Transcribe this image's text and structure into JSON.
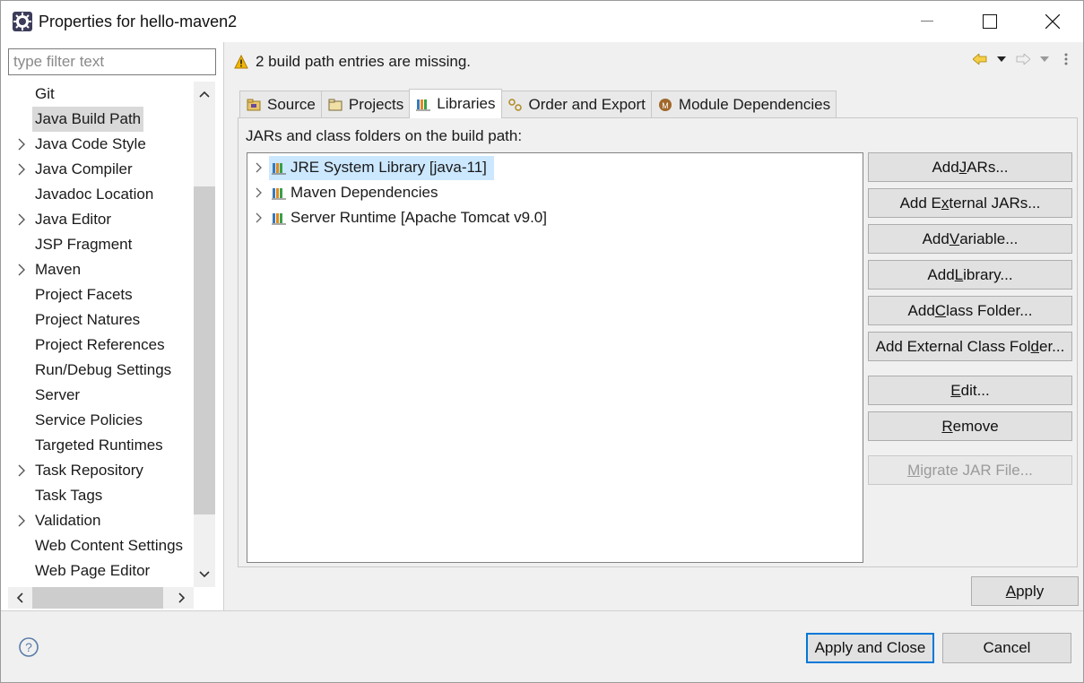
{
  "window": {
    "title": "Properties for hello-maven2"
  },
  "sidebar": {
    "filter_placeholder": "type filter text",
    "items": [
      {
        "label": "Git",
        "expandable": false
      },
      {
        "label": "Java Build Path",
        "expandable": false,
        "selected": true
      },
      {
        "label": "Java Code Style",
        "expandable": true
      },
      {
        "label": "Java Compiler",
        "expandable": true
      },
      {
        "label": "Javadoc Location",
        "expandable": false
      },
      {
        "label": "Java Editor",
        "expandable": true
      },
      {
        "label": "JSP Fragment",
        "expandable": false
      },
      {
        "label": "Maven",
        "expandable": true
      },
      {
        "label": "Project Facets",
        "expandable": false
      },
      {
        "label": "Project Natures",
        "expandable": false
      },
      {
        "label": "Project References",
        "expandable": false
      },
      {
        "label": "Run/Debug Settings",
        "expandable": false
      },
      {
        "label": "Server",
        "expandable": false
      },
      {
        "label": "Service Policies",
        "expandable": false
      },
      {
        "label": "Targeted Runtimes",
        "expandable": false
      },
      {
        "label": "Task Repository",
        "expandable": true
      },
      {
        "label": "Task Tags",
        "expandable": false
      },
      {
        "label": "Validation",
        "expandable": true
      },
      {
        "label": "Web Content Settings",
        "expandable": false
      },
      {
        "label": "Web Page Editor",
        "expandable": false
      }
    ]
  },
  "header": {
    "message": "2 build path entries are missing."
  },
  "tabs": [
    {
      "label": "Source",
      "icon": "source-folder-icon"
    },
    {
      "label": "Projects",
      "icon": "projects-folder-icon"
    },
    {
      "label": "Libraries",
      "icon": "library-icon",
      "active": true
    },
    {
      "label": "Order and Export",
      "icon": "order-export-icon"
    },
    {
      "label": "Module Dependencies",
      "icon": "module-icon"
    }
  ],
  "libraries": {
    "label": "JARs and class folders on the build path:",
    "entries": [
      {
        "label": "JRE System Library [java-11]",
        "selected": true
      },
      {
        "label": "Maven Dependencies"
      },
      {
        "label": "Server Runtime [Apache Tomcat v9.0]"
      }
    ]
  },
  "buttons": {
    "add_jars": [
      "Add ",
      "J",
      "ARs..."
    ],
    "add_external_jars": [
      "Add E",
      "x",
      "ternal JARs..."
    ],
    "add_variable": [
      "Add ",
      "V",
      "ariable..."
    ],
    "add_library": [
      "Add ",
      "L",
      "ibrary..."
    ],
    "add_class_folder": [
      "Add ",
      "C",
      "lass Folder..."
    ],
    "add_external_class_folder": [
      "Add External Class Fol",
      "d",
      "er..."
    ],
    "edit": [
      "",
      "E",
      "dit..."
    ],
    "remove": [
      "",
      "R",
      "emove"
    ],
    "migrate_jar": [
      "",
      "M",
      "igrate JAR File..."
    ],
    "apply": [
      "",
      "A",
      "pply"
    ],
    "apply_and_close": "Apply and Close",
    "cancel": "Cancel"
  },
  "colors": {
    "selection": "#cce8ff",
    "default_button_border": "#0078d7",
    "warning": "#f2b705"
  }
}
